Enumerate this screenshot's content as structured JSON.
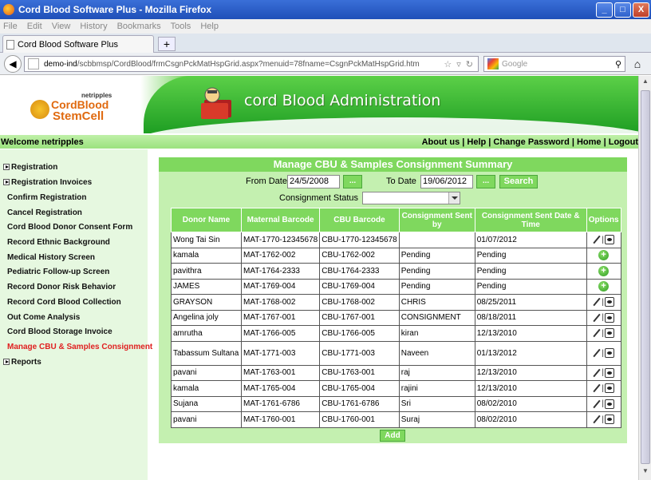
{
  "window": {
    "title": "Cord Blood Software Plus - Mozilla Firefox",
    "minimize": "_",
    "maximize": "□",
    "close": "X"
  },
  "menu": [
    "File",
    "Edit",
    "View",
    "History",
    "Bookmarks",
    "Tools",
    "Help"
  ],
  "tab": {
    "label": "Cord Blood Software Plus",
    "new_tab": "+"
  },
  "nav": {
    "url_host": "demo-ind",
    "url_path": "/scbbmsp/CordBlood/frmCsgnPckMatHspGrid.aspx?menuid=78fname=CsgnPckMatHspGrid.htm",
    "search_placeholder": "Google"
  },
  "banner": {
    "logo_small": "netripples",
    "logo_line1": "CordBlood",
    "logo_line2": "StemCell",
    "title": "cord Blood Administration"
  },
  "welcome": "Welcome netripples",
  "toplinks": "About us | Help | Change Password | Home | Logout",
  "sidebar": [
    {
      "label": "Registration",
      "expand": true
    },
    {
      "label": "Registration Invoices",
      "expand": true
    },
    {
      "label": "Confirm Registration"
    },
    {
      "label": "Cancel Registration"
    },
    {
      "label": "Cord Blood Donor Consent Form"
    },
    {
      "label": "Record Ethnic Background"
    },
    {
      "label": "Medical History Screen"
    },
    {
      "label": "Pediatric Follow-up Screen"
    },
    {
      "label": "Record Donor Risk Behavior"
    },
    {
      "label": "Record Cord Blood Collection"
    },
    {
      "label": "Out Come Analysis"
    },
    {
      "label": "Cord Blood Storage Invoice"
    },
    {
      "label": "Manage CBU & Samples Consignment",
      "active": true
    },
    {
      "label": "Reports",
      "expand": true
    }
  ],
  "main": {
    "title": "Manage CBU & Samples Consignment Summary",
    "from_label": "From Date",
    "from_value": "24/5/2008",
    "to_label": "To Date",
    "to_value": "19/06/2012",
    "cal_label": "...",
    "search_label": "Search",
    "status_label": "Consignment Status",
    "status_value": "",
    "add_label": "Add"
  },
  "table": {
    "headers": [
      "Donor Name",
      "Maternal Barcode",
      "CBU Barcode",
      "Consignment Sent by",
      "Consignment Sent Date & Time",
      "Options"
    ],
    "rows": [
      [
        "Wong Tai Sin",
        "MAT-1770-12345678",
        "CBU-1770-12345678",
        "",
        "01/07/2012",
        "edit"
      ],
      [
        "kamala",
        "MAT-1762-002",
        "CBU-1762-002",
        "Pending",
        "Pending",
        "add"
      ],
      [
        "pavithra",
        "MAT-1764-2333",
        "CBU-1764-2333",
        "Pending",
        "Pending",
        "add"
      ],
      [
        "JAMES",
        "MAT-1769-004",
        "CBU-1769-004",
        "Pending",
        "Pending",
        "add"
      ],
      [
        "GRAYSON",
        "MAT-1768-002",
        "CBU-1768-002",
        "CHRIS",
        "08/25/2011",
        "edit"
      ],
      [
        "Angelina joly",
        "MAT-1767-001",
        "CBU-1767-001",
        "CONSIGNMENT",
        "08/18/2011",
        "edit"
      ],
      [
        "amrutha",
        "MAT-1766-005",
        "CBU-1766-005",
        "kiran",
        "12/13/2010",
        "edit"
      ],
      [
        "Tabassum Sultana",
        "MAT-1771-003",
        "CBU-1771-003",
        "Naveen",
        "01/13/2012",
        "edit"
      ],
      [
        "pavani",
        "MAT-1763-001",
        "CBU-1763-001",
        "raj",
        "12/13/2010",
        "edit"
      ],
      [
        "kamala",
        "MAT-1765-004",
        "CBU-1765-004",
        "rajini",
        "12/13/2010",
        "edit"
      ],
      [
        "Sujana",
        "MAT-1761-6786",
        "CBU-1761-6786",
        "Sri",
        "08/02/2010",
        "edit"
      ],
      [
        "pavani",
        "MAT-1760-001",
        "CBU-1760-001",
        "Suraj",
        "08/02/2010",
        "edit"
      ]
    ]
  },
  "colors": {
    "accent_green": "#7fd85e",
    "panel_green": "#c4f0b0",
    "active_link": "#e02020"
  }
}
